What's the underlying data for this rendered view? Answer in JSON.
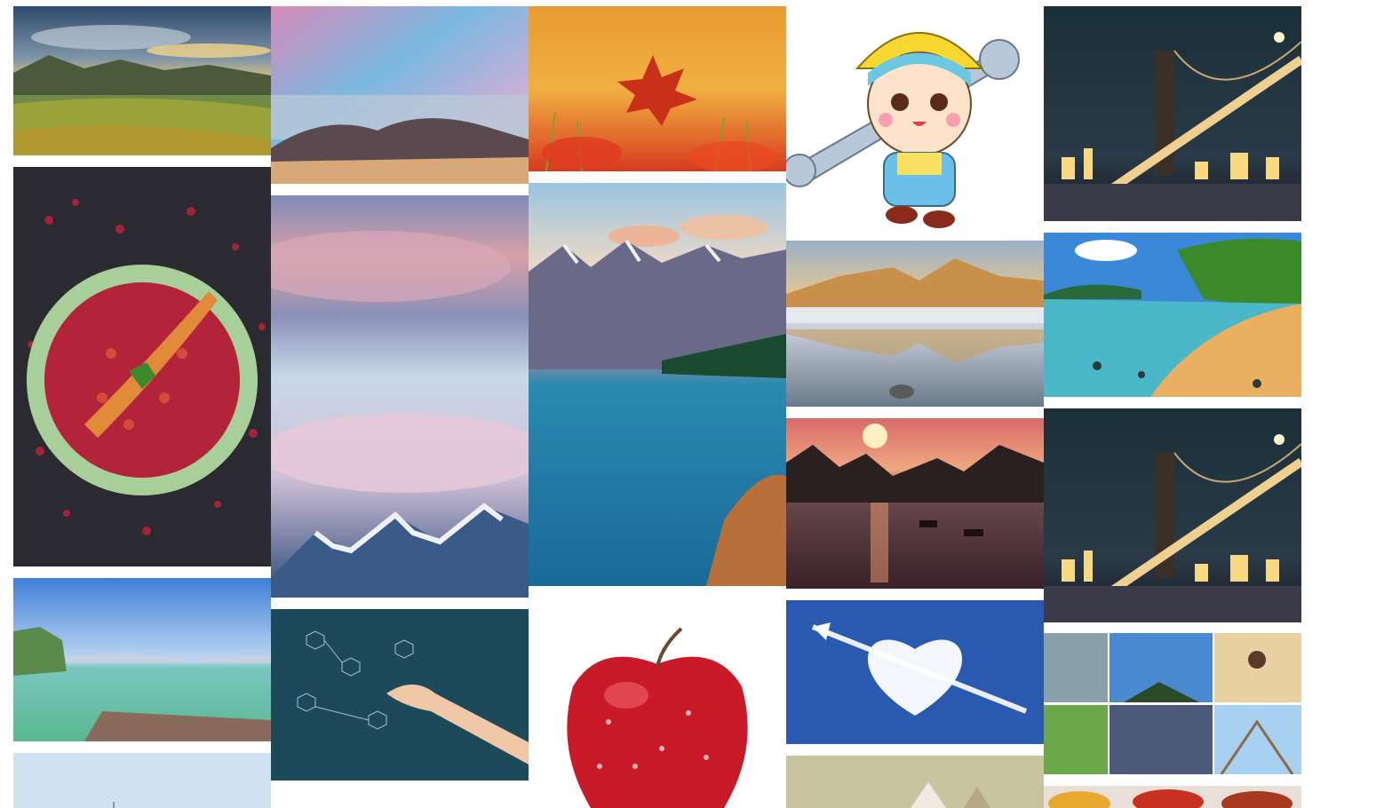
{
  "page": {
    "background": "#ffffff"
  },
  "gallery": {
    "columns": [
      {
        "tiles": [
          {
            "name": "meadow-sunset-landscape"
          },
          {
            "name": "crawfish-chili-dish"
          },
          {
            "name": "turquoise-lake-cliff"
          },
          {
            "name": "pale-sky-partial"
          }
        ]
      },
      {
        "tiles": [
          {
            "name": "rocky-shore-colorful-sky"
          },
          {
            "name": "pink-clouds-snow-mountains"
          },
          {
            "name": "chemistry-formulas-hand"
          }
        ]
      },
      {
        "tiles": [
          {
            "name": "autumn-red-leaf"
          },
          {
            "name": "mountain-lake-turquoise"
          },
          {
            "name": "red-apple-water-drops"
          }
        ]
      },
      {
        "tiles": [
          {
            "name": "cartoon-worker-wrench"
          },
          {
            "name": "misty-mountain-reflection"
          },
          {
            "name": "river-sunset-karst-hills"
          },
          {
            "name": "heart-cloud-blue-sky"
          },
          {
            "name": "cat-partial"
          }
        ]
      },
      {
        "tiles": [
          {
            "name": "night-bridge-city"
          },
          {
            "name": "tropical-beach-sea"
          },
          {
            "name": "night-bridge-city-duplicate"
          },
          {
            "name": "photo-collage-travel"
          },
          {
            "name": "food-bowls-partial"
          }
        ]
      }
    ]
  }
}
